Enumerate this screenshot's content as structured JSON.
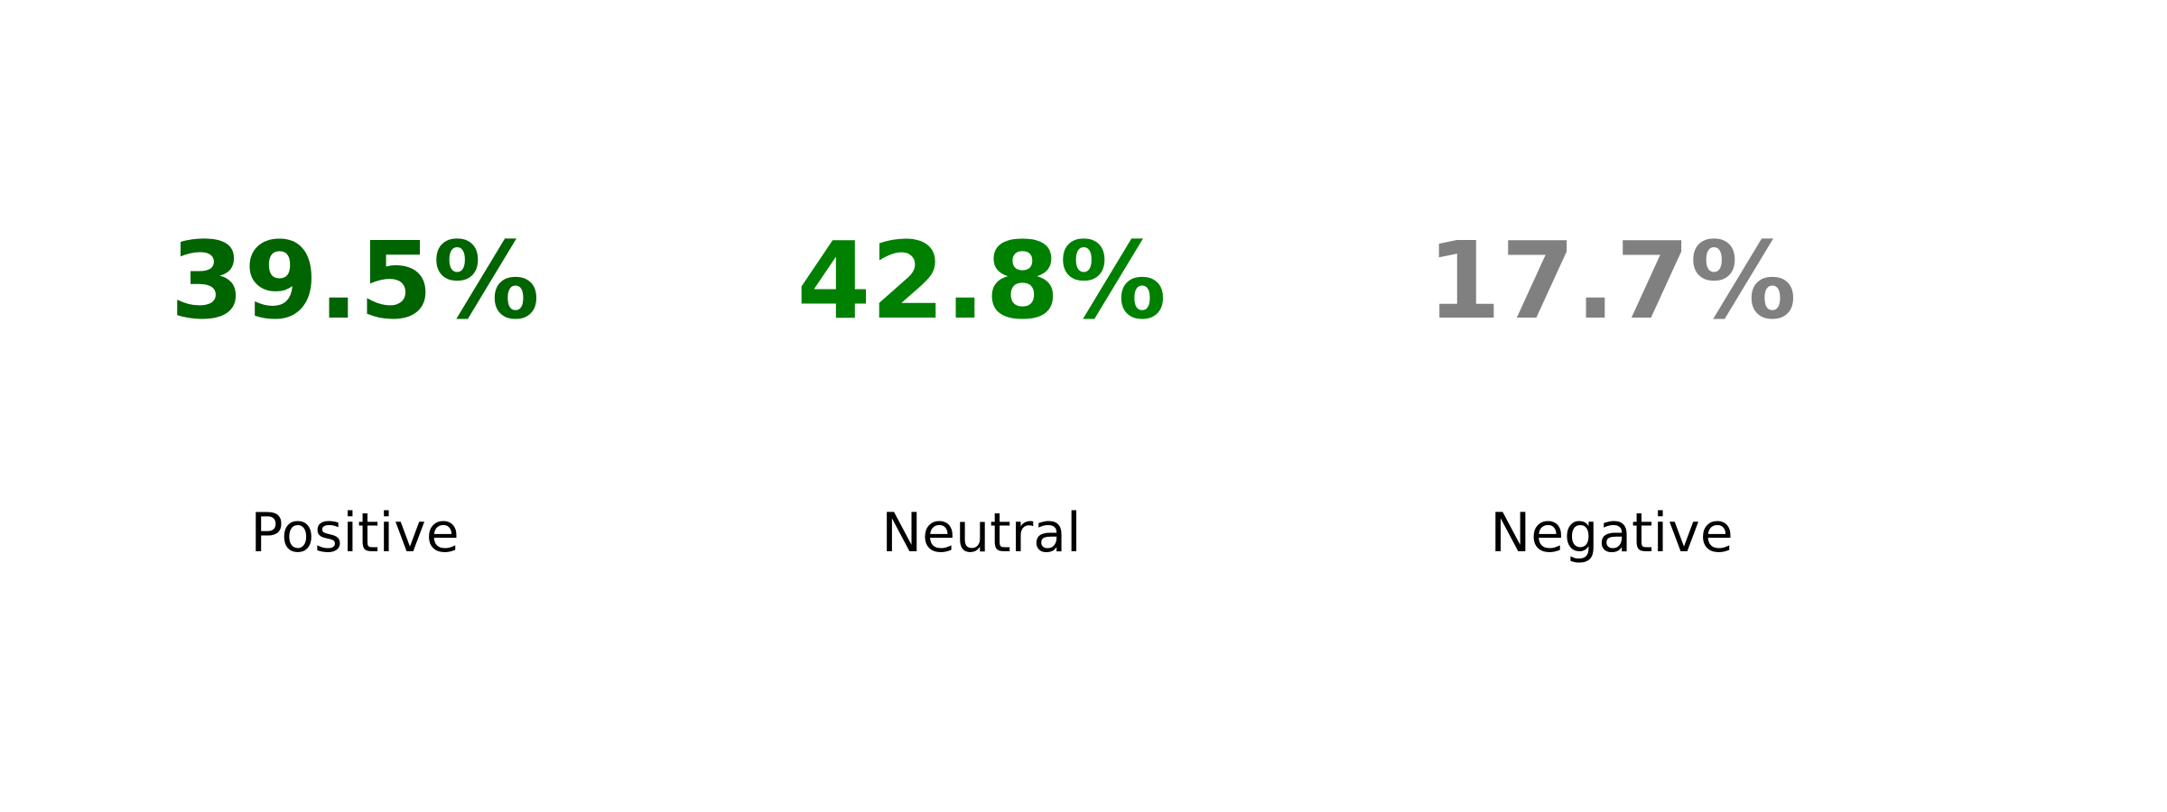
{
  "chart_data": {
    "type": "table",
    "title": "",
    "series": [
      {
        "name": "Positive",
        "value": 39.5,
        "display": "39.5%",
        "label": "Positive",
        "color": "#006400"
      },
      {
        "name": "Neutral",
        "value": 42.8,
        "display": "42.8%",
        "label": "Neutral",
        "color": "#008000"
      },
      {
        "name": "Negative",
        "value": 17.7,
        "display": "17.7%",
        "label": "Negative",
        "color": "#808080"
      }
    ]
  }
}
